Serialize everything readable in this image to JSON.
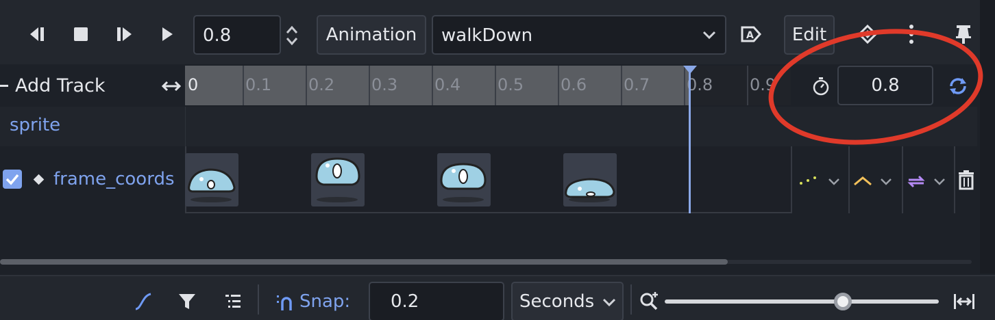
{
  "toolbar": {
    "position_value": "0.8",
    "animation_label": "Animation",
    "animation_name": "walkDown",
    "edit_label": "Edit"
  },
  "timeline": {
    "add_track_label": "Add Track",
    "ruler_labels": [
      "0",
      "0.1",
      "0.2",
      "0.3",
      "0.4",
      "0.5",
      "0.6",
      "0.7",
      "0.8",
      "0.9"
    ],
    "length_value": "0.8"
  },
  "tracks": {
    "group_label": "sprite",
    "track_label": "frame_coords",
    "track_enabled": true
  },
  "bottom_bar": {
    "snap_label": "Snap:",
    "snap_value": "0.2",
    "unit_label": "Seconds",
    "zoom_level": 0.65
  },
  "colors": {
    "accent": "#6f9af5",
    "playhead": "#8aa8e8",
    "annotation": "#e03a2a",
    "interp_yellow": "#f2c05a",
    "loop_purple": "#b58af5",
    "update_green": "#d8e05a"
  },
  "icons": [
    "play-backwards-icon",
    "stop-icon",
    "play-from-start-icon",
    "play-icon",
    "spin-icon",
    "autoplay-icon",
    "onion-skin-icon",
    "more-icon",
    "pin-icon",
    "timer-icon",
    "loop-icon",
    "bezier-icon",
    "filter-icon",
    "track-list-icon",
    "snap-icon",
    "zoom-icon",
    "fit-icon",
    "trash-icon"
  ]
}
